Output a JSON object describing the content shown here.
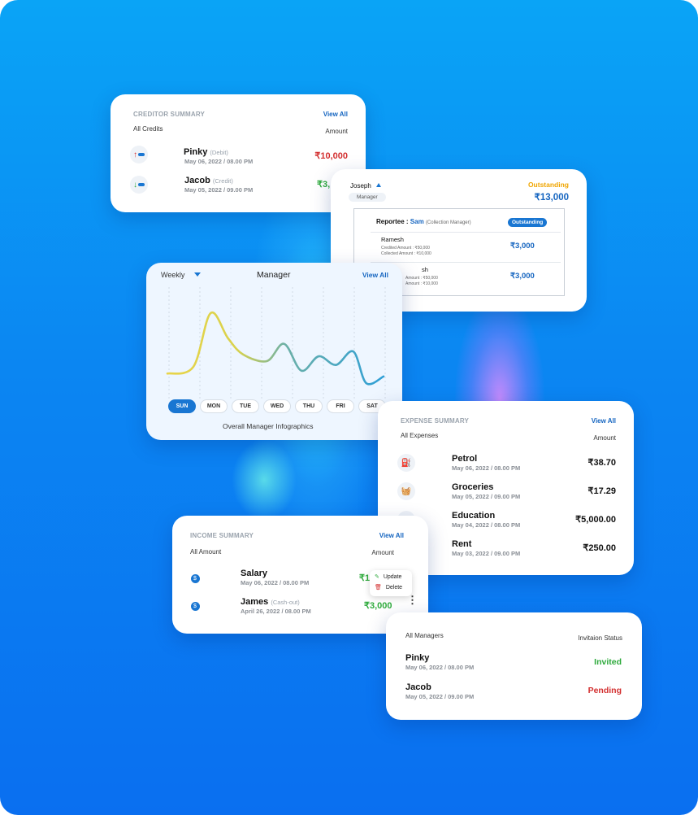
{
  "colors": {
    "accent": "#1565c0",
    "debit": "#d32f2f",
    "credit": "#2eaa3c",
    "outstanding": "#f0a500",
    "background": "#0b86f2"
  },
  "creditor": {
    "title": "CREDITOR SUMMARY",
    "view_all": "View All",
    "subtitle": "All Credits",
    "amount_header": "Amount",
    "rows": [
      {
        "name": "Pinky",
        "tag": "(Debit)",
        "date": "May 06, 2022 / 08.00 PM",
        "amount": "₹10,000",
        "icon": "arrow-up-icon"
      },
      {
        "name": "Jacob",
        "tag": "(Credit)",
        "date": "May 05, 2022 / 09.00 PM",
        "amount": "₹3,",
        "icon": "arrow-down-icon"
      }
    ]
  },
  "outstanding": {
    "manager_name": "Joseph",
    "role_badge": "Manager",
    "status_label": "Outstanding",
    "total": "₹13,000",
    "reportee_label": "Reportee :",
    "reportee_name": "Sam",
    "reportee_role": "(Collection Manager)",
    "reportee_badge": "Outstanding",
    "rows": [
      {
        "name": "Ramesh",
        "credited": "Credited Amount : ₹50,000",
        "collected": "Collected Amount : ₹10,000",
        "amount": "₹3,000"
      },
      {
        "name": "sh",
        "credited": "Amount : ₹50,000",
        "collected": "Amount : ₹10,000",
        "amount": "₹3,000"
      }
    ]
  },
  "chart_card": {
    "period": "Weekly",
    "title": "Manager",
    "view_all": "View All",
    "caption": "Overall Manager Infographics",
    "days": [
      "SUN",
      "MON",
      "TUE",
      "WED",
      "THU",
      "FRI",
      "SAT"
    ],
    "active_day": "SUN"
  },
  "chart_data": {
    "type": "line",
    "title": "Manager",
    "xlabel": "",
    "ylabel": "",
    "x": [
      "SUN",
      "MON",
      "TUE",
      "WED",
      "THU",
      "FRI",
      "SAT"
    ],
    "series": [
      {
        "values": [
          0.18,
          0.22,
          0.82,
          0.55,
          0.4,
          0.33,
          0.28,
          0.46,
          0.36,
          0.24,
          0.3,
          0.21,
          0.14,
          0.2
        ]
      }
    ],
    "points": [
      {
        "x": 0.0,
        "y": 0.15
      },
      {
        "x": 0.12,
        "y": 0.22
      },
      {
        "x": 0.2,
        "y": 0.78
      },
      {
        "x": 0.28,
        "y": 0.52
      },
      {
        "x": 0.35,
        "y": 0.35
      },
      {
        "x": 0.46,
        "y": 0.28
      },
      {
        "x": 0.54,
        "y": 0.46
      },
      {
        "x": 0.62,
        "y": 0.18
      },
      {
        "x": 0.7,
        "y": 0.33
      },
      {
        "x": 0.78,
        "y": 0.24
      },
      {
        "x": 0.86,
        "y": 0.38
      },
      {
        "x": 0.92,
        "y": 0.05
      },
      {
        "x": 1.0,
        "y": 0.12
      }
    ],
    "grid": true
  },
  "expense": {
    "title": "EXPENSE SUMMARY",
    "view_all": "View All",
    "subtitle": "All Expenses",
    "amount_header": "Amount",
    "rows": [
      {
        "name": "Petrol",
        "date": "May 06, 2022 / 08.00 PM",
        "amount": "₹38.70",
        "icon": "fuel-icon"
      },
      {
        "name": "Groceries",
        "date": "May 05, 2022 / 09.00 PM",
        "amount": "₹17.29",
        "icon": "basket-icon"
      },
      {
        "name": "Education",
        "date": "May 04, 2022 / 08.00 PM",
        "amount": "₹5,000.00",
        "icon": "book-icon"
      },
      {
        "name": "Rent",
        "date": "May 03, 2022 / 09.00 PM",
        "amount": "₹250.00",
        "icon": "home-icon"
      }
    ]
  },
  "income": {
    "title": "INCOME SUMMARY",
    "view_all": "View All",
    "subtitle": "All Amount",
    "amount_header": "Amount",
    "rows": [
      {
        "name": "Salary",
        "tag": "",
        "date": "May 06, 2022 / 08.00 PM",
        "amount": "₹1(",
        "icon": "coin-icon"
      },
      {
        "name": "James",
        "tag": "(Cash-out)",
        "date": "April 26, 2022 / 08.00 PM",
        "amount": "₹3,000",
        "icon": "coin-icon"
      }
    ],
    "menu": {
      "update": "Update",
      "delete": "Delete"
    }
  },
  "managers": {
    "title": "All Managers",
    "status_header": "Invitaion Status",
    "rows": [
      {
        "name": "Pinky",
        "date": "May 06, 2022 / 08.00 PM",
        "status": "Invited"
      },
      {
        "name": "Jacob",
        "date": "May 05, 2022 / 09.00 PM",
        "status": "Pending"
      }
    ]
  }
}
